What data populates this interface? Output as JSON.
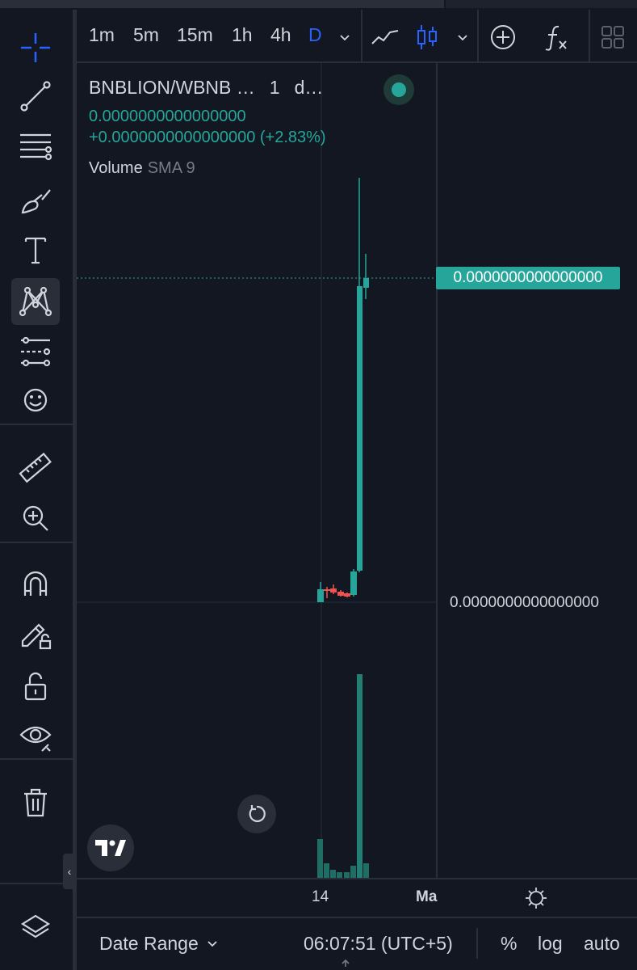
{
  "timeframes": [
    "1m",
    "5m",
    "15m",
    "1h",
    "4h",
    "D"
  ],
  "active_timeframe": "D",
  "legend": {
    "symbol": "BNBLION/WBNB …",
    "interval": "1",
    "exchange": "d…",
    "price": "0.0000000000000000",
    "change": "+0.0000000000000000 (+2.83%)"
  },
  "volume_label": "Volume",
  "volume_indicator": "SMA 9",
  "price_axis": {
    "last_price_tag": "0.0000000000000000",
    "tick_label": "0.0000000000000000"
  },
  "time_axis": {
    "labels": [
      "14",
      "Ma"
    ]
  },
  "bottom_bar": {
    "date_range": "Date Range",
    "clock": "06:07:51 (UTC+5)",
    "percent": "%",
    "log": "log",
    "auto": "auto"
  },
  "colors": {
    "background": "#131722",
    "up": "#26a69a",
    "down": "#ef5350",
    "accent": "#2962ff",
    "text": "#d1d4dc"
  },
  "chart_data": {
    "type": "candlestick",
    "candles_visible": 9,
    "price_values_shown": "0.0000000000000000",
    "change_percent": 2.83,
    "volume_series": "Volume",
    "x_labels": [
      "14",
      "Ma"
    ]
  },
  "left_tools": [
    "crosshair-icon",
    "trend-line-icon",
    "fib-icon",
    "brush-icon",
    "text-icon",
    "pattern-icon",
    "forecast-icon",
    "emoji-icon",
    "ruler-icon",
    "zoom-in-icon",
    "magnet-icon",
    "lock-drawing-icon",
    "unlock-icon",
    "eye-icon",
    "trash-icon",
    "layers-icon"
  ]
}
